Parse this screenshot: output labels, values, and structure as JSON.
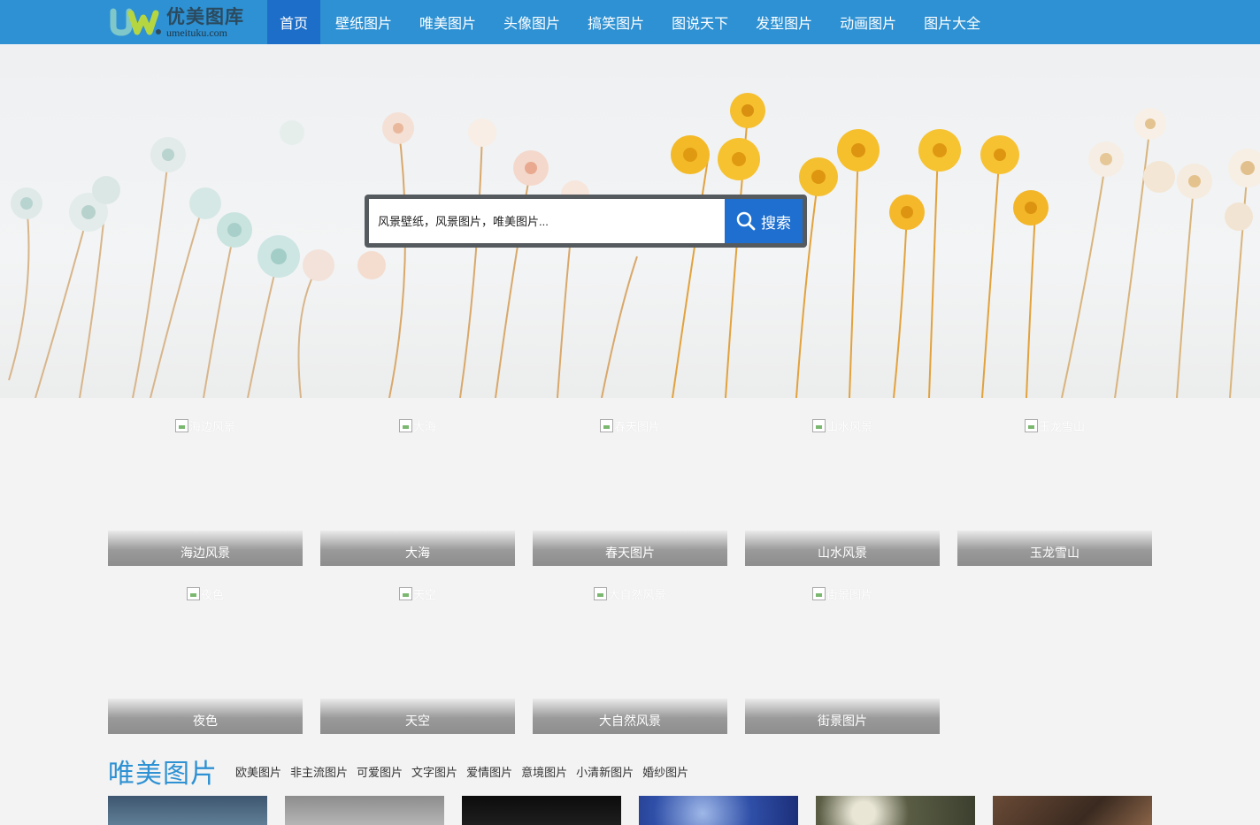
{
  "nav": {
    "logo_cn": "优美图库",
    "logo_en": "umeituku.com",
    "items": [
      {
        "label": "首页"
      },
      {
        "label": "壁纸图片"
      },
      {
        "label": "唯美图片"
      },
      {
        "label": "头像图片"
      },
      {
        "label": "搞笑图片"
      },
      {
        "label": "图说天下"
      },
      {
        "label": "发型图片"
      },
      {
        "label": "动画图片"
      },
      {
        "label": "图片大全"
      }
    ]
  },
  "search": {
    "placeholder": "风景壁纸，风景图片，唯美图片...",
    "button_label": "搜索"
  },
  "categories": [
    {
      "label": "海边风景",
      "alt": "海边风景"
    },
    {
      "label": "大海",
      "alt": "大海"
    },
    {
      "label": "春天图片",
      "alt": "春天图片"
    },
    {
      "label": "山水风景",
      "alt": "山水风景"
    },
    {
      "label": "玉龙雪山",
      "alt": "玉龙雪山"
    },
    {
      "label": "夜色",
      "alt": "夜色"
    },
    {
      "label": "天空",
      "alt": "天空"
    },
    {
      "label": "大自然风景",
      "alt": "大自然风景"
    },
    {
      "label": "街景图片",
      "alt": "街景图片"
    }
  ],
  "section": {
    "title": "唯美图片",
    "links": [
      "欧美图片",
      "非主流图片",
      "可爱图片",
      "文字图片",
      "爱情图片",
      "意境图片",
      "小清新图片",
      "婚纱图片"
    ]
  },
  "colors": {
    "nav_bg": "#2d91d3",
    "nav_active": "#1d6ec9",
    "search_button": "#1e6fd0",
    "section_title": "#2d91d3"
  }
}
